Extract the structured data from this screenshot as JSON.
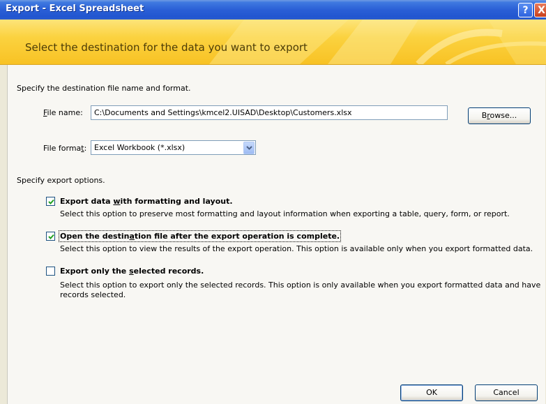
{
  "window": {
    "title": "Export - Excel Spreadsheet",
    "help_label": "?",
    "close_label": "X"
  },
  "banner": {
    "heading": "Select the destination for the data you want to export"
  },
  "destination": {
    "instruction": "Specify the destination file name and format.",
    "file_name_label": "File name:",
    "file_name_value": "C:\\Documents and Settings\\kmcel2.UISAD\\Desktop\\Customers.xlsx",
    "browse_label": "Browse...",
    "file_format_label": "File format:",
    "file_format_value": "Excel Workbook (*.xlsx)"
  },
  "export_options": {
    "heading": "Specify export options.",
    "options": [
      {
        "title": "Export data with formatting and layout.",
        "checked": true,
        "description": "Select this option to preserve most formatting and layout information when exporting a table, query, form, or report."
      },
      {
        "title": "Open the destination file after the export operation is complete.",
        "checked": true,
        "description": "Select this option to view the results of the export operation. This option is available only when you export formatted data."
      },
      {
        "title": "Export only the selected records.",
        "checked": false,
        "description": "Select this option to export only the selected records. This option is only available when you export formatted data and have records selected."
      }
    ]
  },
  "footer": {
    "ok_label": "OK",
    "cancel_label": "Cancel"
  },
  "colors": {
    "titlebar": "#2256d0",
    "banner": "#fbd23f",
    "checkmark": "#21a121"
  }
}
